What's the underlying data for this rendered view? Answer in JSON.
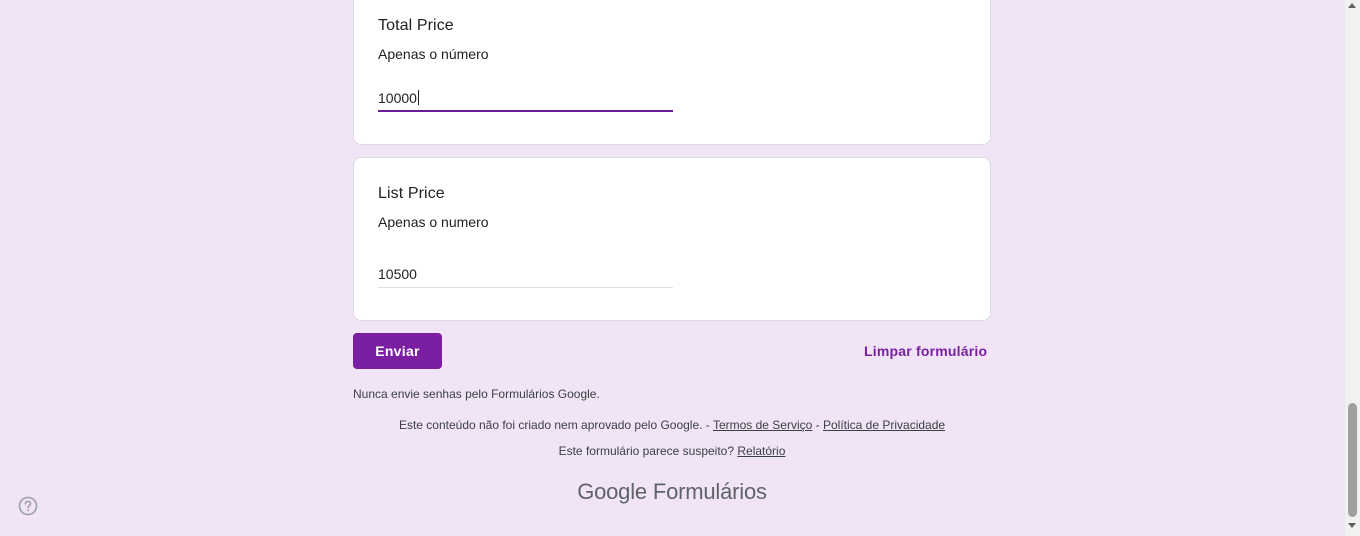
{
  "questions": [
    {
      "title": "Total Price",
      "description": "Apenas o número",
      "value": "10000"
    },
    {
      "title": "List Price",
      "description": "Apenas o numero",
      "value": "10500"
    }
  ],
  "actions": {
    "submit_label": "Enviar",
    "clear_label": "Limpar formulário"
  },
  "footer": {
    "warning": "Nunca envie senhas pelo Formulários Google.",
    "disclaimer": "Este conteúdo não foi criado nem aprovado pelo Google. - ",
    "terms_label": "Termos de Serviço",
    "separator": " - ",
    "privacy_label": "Política de Privacidade",
    "suspicious_text": "Este formulário parece suspeito? ",
    "report_label": "Relatório",
    "brand_google": "Google",
    "brand_product": "Formulários"
  },
  "icons": {
    "help": "help-icon"
  },
  "colors": {
    "background": "#f0e4f6",
    "accent": "#7b1fa2",
    "active_underline": "#6a1b9a"
  }
}
